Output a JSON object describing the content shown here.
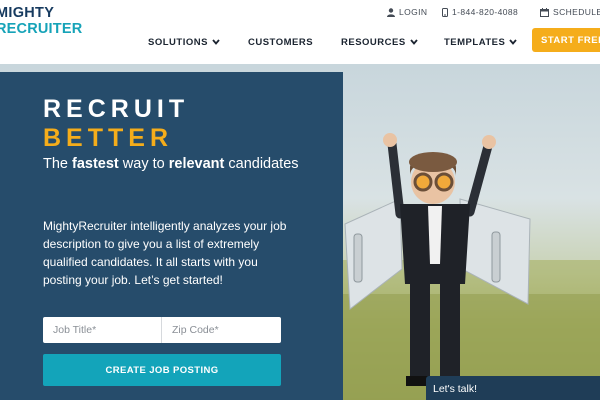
{
  "logo": {
    "line1": "MIGHTY",
    "line2": "RECRUITER"
  },
  "utility": {
    "login": "LOGIN",
    "phone": "1-844-820-4088",
    "schedule": "SCHEDULE"
  },
  "nav": {
    "solutions": "SOLUTIONS",
    "customers": "CUSTOMERS",
    "resources": "RESOURCES",
    "templates": "TEMPLATES",
    "start": "START FREE"
  },
  "hero": {
    "recruit": "RECRUIT",
    "better": "BETTER",
    "tagline_pre": "The ",
    "tagline_bold1": "fastest",
    "tagline_mid": " way to ",
    "tagline_bold2": "relevant",
    "tagline_post": " candidates",
    "description": "MightyRecruiter intelligently analyzes your job description to give you a list of extremely qualified candidates. It all starts with you posting your job. Let’s get started!"
  },
  "form": {
    "job_title_placeholder": "Job Title*",
    "zip_placeholder": "Zip Code*",
    "submit": "CREATE JOB POSTING"
  },
  "chat": {
    "label": "Let's talk!"
  },
  "colors": {
    "navy": "#264c6b",
    "teal": "#13a4ba",
    "orange": "#f5ad1b",
    "logo_dark": "#163a5f",
    "logo_teal": "#16a3b8"
  },
  "icons": [
    "user-icon",
    "phone-icon",
    "calendar-icon",
    "chevron-down-icon"
  ]
}
